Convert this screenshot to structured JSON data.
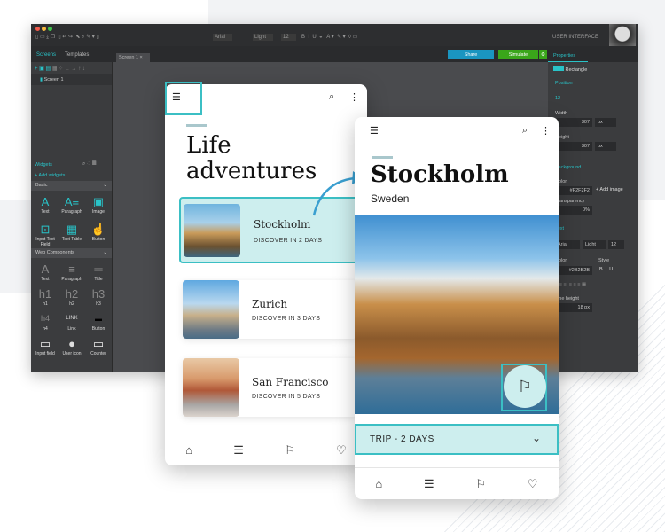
{
  "toolbar": {
    "font": "Arial",
    "weight": "Light",
    "size": "12",
    "workspace": "USER INTERFACE",
    "share": "Share",
    "simulate": "Simulate"
  },
  "left": {
    "tabs": [
      "Screens",
      "Templates"
    ],
    "screen": "Screen 1",
    "widgets_tab": "Widgets",
    "add_widgets": "+ Add widgets",
    "basic": "Basic",
    "basic_items": [
      "Text",
      "Paragraph",
      "Image",
      "Input Text Field",
      "Text Table",
      "Button"
    ],
    "web": "Web Components",
    "web_items": [
      "Text",
      "Paragraph",
      "Title",
      "h1",
      "h2",
      "h3",
      "h4",
      "Link",
      "Button",
      "Input field",
      "User icon",
      "Counter"
    ]
  },
  "canvas": {
    "tab": "Screen 1"
  },
  "props": {
    "tab": "Properties",
    "element": "Rectangle",
    "position": "Position",
    "size": "12",
    "width_label": "Width",
    "width": "307",
    "height_label": "Height",
    "height": "307",
    "unit": "px",
    "background": "Background",
    "color_label": "Color",
    "bg_color": "#F2F2F2",
    "add_image": "+ Add image",
    "transparency_label": "Transparency",
    "transparency": "0%",
    "text": "Text",
    "font": "Arial",
    "weight": "Light",
    "text_color_label": "Color",
    "text_color": "#2B2B2B",
    "style_label": "Style",
    "line_height_label": "Line height",
    "line_height": "18 px"
  },
  "phone1": {
    "title": "Life adventures",
    "cards": [
      {
        "city": "Stockholm",
        "sub": "DISCOVER IN 2 DAYS"
      },
      {
        "city": "Zurich",
        "sub": "DISCOVER IN 3 DAYS"
      },
      {
        "city": "San Francisco",
        "sub": "DISCOVER IN 5 DAYS"
      }
    ]
  },
  "phone2": {
    "title": "Stockholm",
    "subtitle": "Sweden",
    "dropdown": "TRIP - 2 DAYS"
  },
  "colors": {
    "accent": "#3bbfc4",
    "highlight": "#cdeeee",
    "share": "#1a95c0",
    "simulate": "#3aa61a"
  }
}
